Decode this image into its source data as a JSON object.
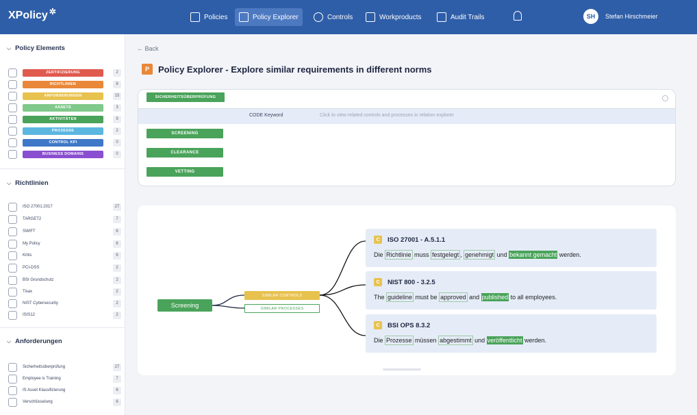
{
  "app": {
    "logo": "XPolicy",
    "logo_spark": "✲"
  },
  "nav": {
    "items": [
      {
        "label": "Policies",
        "active": false
      },
      {
        "label": "Policy Explorer",
        "active": true
      },
      {
        "label": "Controls",
        "active": false
      },
      {
        "label": "Workproducts",
        "active": false
      },
      {
        "label": "Audit Trails",
        "active": false
      }
    ],
    "user_initials": "SH",
    "user_name": "Stefan Hirschmeier"
  },
  "sidebar": {
    "policy_elements": {
      "title": "Policy Elements",
      "items": [
        {
          "label": "ZERTIFIZIERUNG",
          "count": "2",
          "color": "#e05a4e"
        },
        {
          "label": "RICHTLINIEN",
          "count": "8",
          "color": "#e9883a"
        },
        {
          "label": "ANFORDERUNGEN",
          "count": "15",
          "color": "#e8c24f"
        },
        {
          "label": "ASSETS",
          "count": "3",
          "color": "#7fc98a"
        },
        {
          "label": "AKTIVITÄTEN",
          "count": "9",
          "color": "#4aa35a"
        },
        {
          "label": "PROZESSE",
          "count": "2",
          "color": "#5bb6e0"
        },
        {
          "label": "CONTROL KPI",
          "count": "0",
          "color": "#3f78c8"
        },
        {
          "label": "BUSINESS DOMAINS",
          "count": "0",
          "color": "#8a4ed0"
        }
      ]
    },
    "richtlinien": {
      "title": "Richtlinien",
      "items": [
        {
          "label": "ISO 27001:2017",
          "count": "27"
        },
        {
          "label": "TARGET2",
          "count": "7"
        },
        {
          "label": "SWIFT",
          "count": "6"
        },
        {
          "label": "My Policy",
          "count": "6"
        },
        {
          "label": "Kritis",
          "count": "6"
        },
        {
          "label": "PCI-DSS",
          "count": "2"
        },
        {
          "label": "BSI Grundschutz",
          "count": "2"
        },
        {
          "label": "Tisax",
          "count": "2"
        },
        {
          "label": "NIST Cybersecurity",
          "count": "2"
        },
        {
          "label": "ISIS12",
          "count": "2"
        }
      ]
    },
    "anforderungen": {
      "title": "Anforderungen",
      "items": [
        {
          "label": "Sicherheitsüberprüfung",
          "count": "27"
        },
        {
          "label": "Employee is Training",
          "count": "7"
        },
        {
          "label": "IS Asset Klassifizierung",
          "count": "6"
        },
        {
          "label": "Verschlüsselung",
          "count": "6"
        }
      ]
    }
  },
  "main": {
    "back": "← Back",
    "title_badge": "P",
    "title": "Policy Explorer - Explore similar requirements in different norms",
    "search": {
      "value": "Sicherheitsüberprüfung",
      "result_type": "CODE Keyword",
      "result_desc": "Click to view related controls and processes in relation explorer",
      "results": [
        "SICHERHEITSÜBERPRÜFUNG",
        "SCREENING",
        "CLEARANCE",
        "VETTING"
      ]
    },
    "graph": {
      "root": "Screening",
      "branch_controls": "SIMILAR CONTROLS",
      "branch_processes": "SIMILAR PROCESSES",
      "requirements": [
        {
          "badge": "C",
          "title": "ISO 27001 - A.5.1.1",
          "segments": [
            {
              "t": "Die ",
              "h": ""
            },
            {
              "t": "Richtlinie",
              "h": "o"
            },
            {
              "t": " muss ",
              "h": ""
            },
            {
              "t": "festgelegt",
              "h": "o"
            },
            {
              "t": ", ",
              "h": ""
            },
            {
              "t": "genehmigt",
              "h": "o"
            },
            {
              "t": " und ",
              "h": ""
            },
            {
              "t": "bekannt gemacht",
              "h": "f"
            },
            {
              "t": " werden.",
              "h": ""
            }
          ]
        },
        {
          "badge": "C",
          "title": "NIST 800 - 3.2.5",
          "segments": [
            {
              "t": "The ",
              "h": ""
            },
            {
              "t": "guideline",
              "h": "o"
            },
            {
              "t": " must be ",
              "h": ""
            },
            {
              "t": "approved",
              "h": "o"
            },
            {
              "t": " and ",
              "h": ""
            },
            {
              "t": "published",
              "h": "f"
            },
            {
              "t": " to all employees.",
              "h": ""
            }
          ]
        },
        {
          "badge": "C",
          "title": "BSI OPS 8.3.2",
          "segments": [
            {
              "t": "Die ",
              "h": ""
            },
            {
              "t": "Prozesse",
              "h": "o"
            },
            {
              "t": " müssen ",
              "h": ""
            },
            {
              "t": "abgestimmt",
              "h": "o"
            },
            {
              "t": " und ",
              "h": ""
            },
            {
              "t": "veröffentlicht",
              "h": "f"
            },
            {
              "t": " werden.",
              "h": ""
            }
          ]
        }
      ]
    }
  }
}
